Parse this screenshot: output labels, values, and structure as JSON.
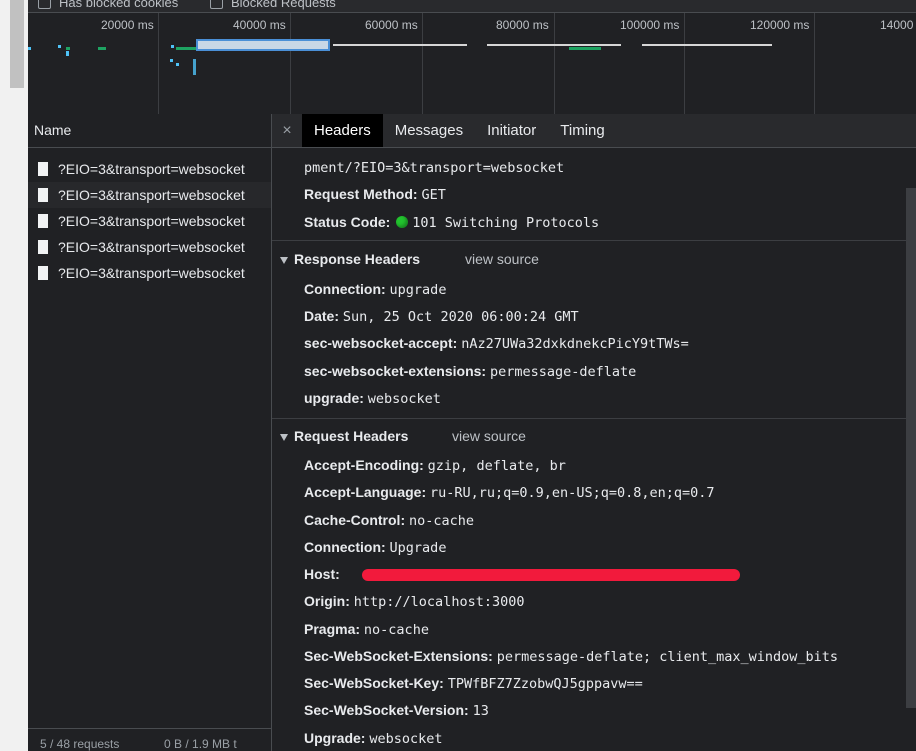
{
  "filterbar": {
    "has_blocked_cookies": "Has blocked cookies",
    "blocked_requests": "Blocked Requests"
  },
  "overview": {
    "ticks": [
      "20000 ms",
      "40000 ms",
      "60000 ms",
      "80000 ms",
      "100000 ms",
      "120000 ms",
      "14000"
    ]
  },
  "name_panel": {
    "header": "Name",
    "rows": [
      "?EIO=3&transport=websocket",
      "?EIO=3&transport=websocket",
      "?EIO=3&transport=websocket",
      "?EIO=3&transport=websocket",
      "?EIO=3&transport=websocket"
    ],
    "status_requests": "5 / 48 requests",
    "status_size": "0 B / 1.9 MB t"
  },
  "tabs": {
    "close": "×",
    "items": [
      "Headers",
      "Messages",
      "Initiator",
      "Timing"
    ],
    "active": "Headers"
  },
  "general": {
    "url_tail": "pment/?EIO=3&transport=websocket",
    "request_method_key": "Request Method:",
    "request_method_val": "GET",
    "status_code_key": "Status Code:",
    "status_code_val": "101 Switching Protocols"
  },
  "response_headers": {
    "title": "Response Headers",
    "view_source": "view source",
    "items": [
      {
        "k": "Connection:",
        "v": "upgrade"
      },
      {
        "k": "Date:",
        "v": "Sun, 25 Oct 2020 06:00:24 GMT"
      },
      {
        "k": "sec-websocket-accept:",
        "v": "nAz27UWa32dxkdnekcPicY9tTWs="
      },
      {
        "k": "sec-websocket-extensions:",
        "v": "permessage-deflate"
      },
      {
        "k": "upgrade:",
        "v": "websocket"
      }
    ]
  },
  "request_headers": {
    "title": "Request Headers",
    "view_source": "view source",
    "items": [
      {
        "k": "Accept-Encoding:",
        "v": "gzip, deflate, br"
      },
      {
        "k": "Accept-Language:",
        "v": "ru-RU,ru;q=0.9,en-US;q=0.8,en;q=0.7"
      },
      {
        "k": "Cache-Control:",
        "v": "no-cache"
      },
      {
        "k": "Connection:",
        "v": "Upgrade"
      },
      {
        "k": "Host:",
        "v": ""
      },
      {
        "k": "Origin:",
        "v": "http://localhost:3000"
      },
      {
        "k": "Pragma:",
        "v": "no-cache"
      },
      {
        "k": "Sec-WebSocket-Extensions:",
        "v": "permessage-deflate; client_max_window_bits"
      },
      {
        "k": "Sec-WebSocket-Key:",
        "v": "TPWfBFZ7ZzobwQJ5gppavw=="
      },
      {
        "k": "Sec-WebSocket-Version:",
        "v": "13"
      },
      {
        "k": "Upgrade:",
        "v": "websocket"
      }
    ]
  },
  "colors": {
    "panel_bg": "#202124",
    "text": "#e8eaed",
    "status_green": "#22c32e",
    "redaction": "#f21a3c",
    "timeline_green": "#1ea362",
    "timeline_blue": "#4fc3f7"
  }
}
